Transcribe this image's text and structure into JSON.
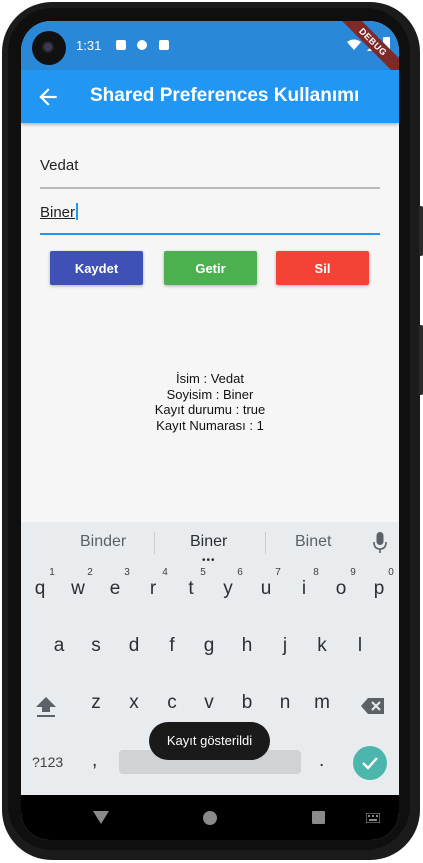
{
  "status_bar": {
    "time": "1:31",
    "debug_label": "DEBUG"
  },
  "app_bar": {
    "title": "Shared Preferences Kullanımı"
  },
  "form": {
    "first_name_value": "Vedat",
    "last_name_value": "Biner"
  },
  "buttons": {
    "save_label": "Kaydet",
    "get_label": "Getir",
    "delete_label": "Sil",
    "colors": {
      "save": "#3f51b5",
      "get": "#4caf50",
      "delete": "#f44336"
    }
  },
  "info": {
    "line1": "İsim : Vedat",
    "line2": "Soyisim : Biner",
    "line3": "Kayıt durumu : true",
    "line4": "Kayıt Numarası : 1"
  },
  "keyboard": {
    "suggestions": [
      "Binder",
      "Biner",
      "Binet"
    ],
    "row1": [
      "q",
      "w",
      "e",
      "r",
      "t",
      "y",
      "u",
      "i",
      "o",
      "p"
    ],
    "row1_numbers": [
      "1",
      "2",
      "3",
      "4",
      "5",
      "6",
      "7",
      "8",
      "9",
      "0"
    ],
    "row2": [
      "a",
      "s",
      "d",
      "f",
      "g",
      "h",
      "j",
      "k",
      "l"
    ],
    "row3": [
      "z",
      "x",
      "c",
      "v",
      "b",
      "n",
      "m"
    ],
    "symbols_label": "?123",
    "comma": ",",
    "period": "."
  },
  "toast": {
    "message": "Kayıt gösterildi"
  },
  "colors": {
    "app_bar": "#2196f3",
    "accent": "#2196f3",
    "enter_key": "#4db6ac"
  }
}
